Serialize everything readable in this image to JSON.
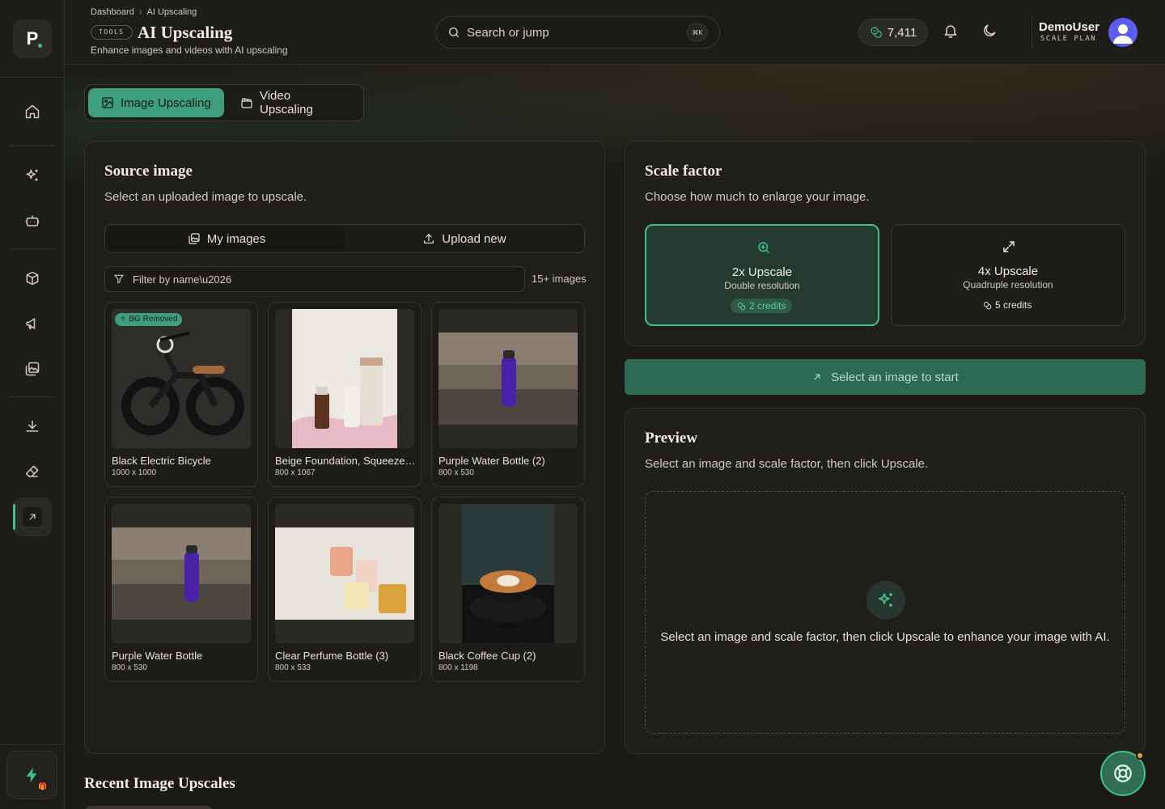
{
  "breadcrumb": {
    "items": [
      "Dashboard",
      "AI Upscaling"
    ]
  },
  "header": {
    "badge": "TOOLS",
    "title": "AI Upscaling",
    "subtitle": "Enhance images and videos with AI upscaling",
    "search_placeholder": "Search or jump",
    "search_shortcut": "⌘K",
    "credits": "7,411",
    "user_name": "DemoUser",
    "user_plan": "SCALE PLAN"
  },
  "tabs": [
    {
      "label": "Image Upscaling",
      "active": true
    },
    {
      "label": "Video Upscaling",
      "active": false
    }
  ],
  "source": {
    "title": "Source image",
    "subtitle": "Select an uploaded image to upscale.",
    "seg_my_images": "My images",
    "seg_upload": "Upload new",
    "filter_placeholder": "Filter by name\\u2026",
    "count": "15+ images",
    "images": [
      {
        "name": "Black Electric Bicycle",
        "dims": "1000 x 1000",
        "badge": "BG Removed"
      },
      {
        "name": "Beige Foundation, Squeeze Tubes",
        "dims": "800 x 1067"
      },
      {
        "name": "Purple Water Bottle (2)",
        "dims": "800 x 530"
      },
      {
        "name": "Purple Water Bottle",
        "dims": "800 x 530"
      },
      {
        "name": "Clear Perfume Bottle (3)",
        "dims": "800 x 533"
      },
      {
        "name": "Black Coffee Cup (2)",
        "dims": "800 x 1198"
      }
    ]
  },
  "scale": {
    "title": "Scale factor",
    "subtitle": "Choose how much to enlarge your image.",
    "options": [
      {
        "title": "2x Upscale",
        "desc": "Double resolution",
        "credits": "2 credits",
        "selected": true
      },
      {
        "title": "4x Upscale",
        "desc": "Quadruple resolution",
        "credits": "5 credits",
        "selected": false
      }
    ]
  },
  "cta_label": "Select an image to start",
  "preview": {
    "title": "Preview",
    "subtitle": "Select an image and scale factor, then click Upscale.",
    "empty_text": "Select an image and scale factor, then click Upscale to enhance your image with AI."
  },
  "recent_title": "Recent Image Upscales",
  "colors": {
    "accent": "#3fbf8a",
    "accent_dark": "#2d6a53",
    "background": "#1b1a16"
  }
}
